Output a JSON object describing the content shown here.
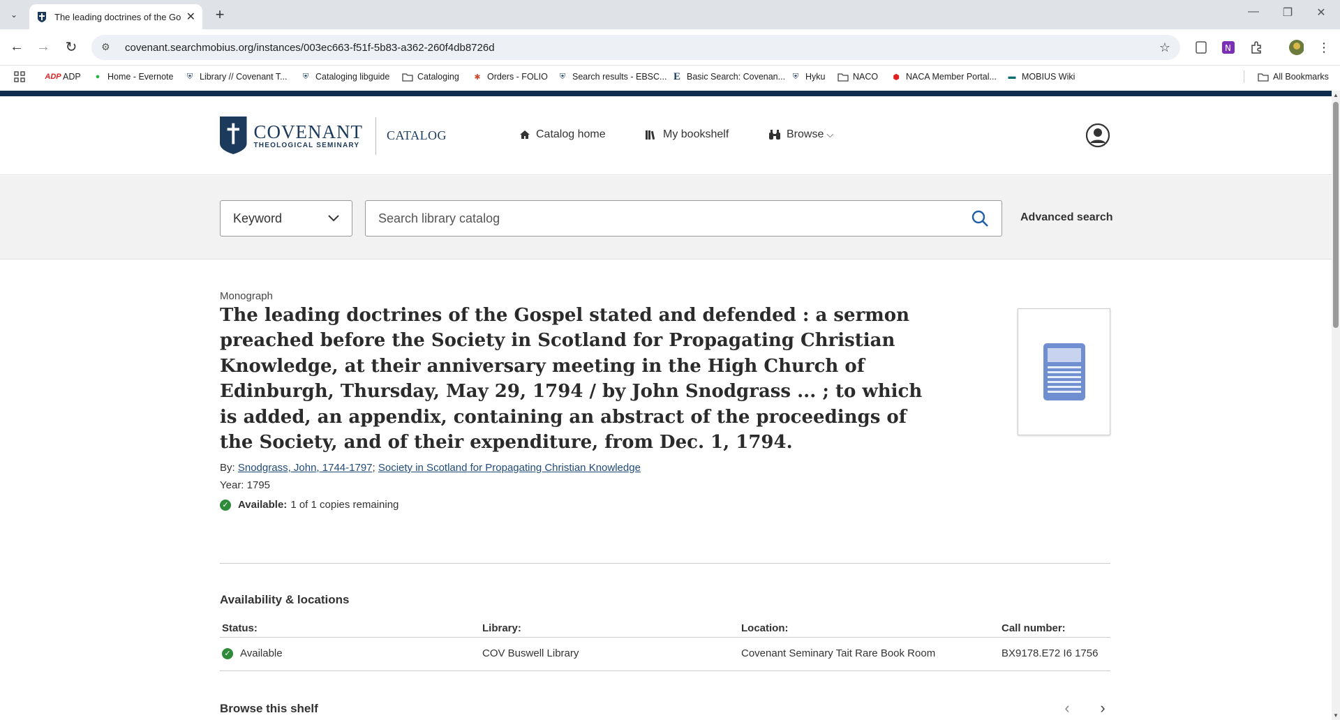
{
  "browser": {
    "tab_title": "The leading doctrines of the Gosp",
    "url": "covenant.searchmobius.org/instances/003ec663-f51f-5b83-a362-260f4db8726d",
    "bookmarks": [
      "ADP",
      "Home - Evernote",
      "Library // Covenant T...",
      "Cataloging libguide",
      "Cataloging",
      "Orders - FOLIO",
      "Search results - EBSC...",
      "Basic Search: Covenan...",
      "Hyku",
      "NACO",
      "NACA Member Portal...",
      "MOBIUS Wiki"
    ],
    "all_bookmarks": "All Bookmarks",
    "icons": [
      "back-icon",
      "forward-icon",
      "reload-icon",
      "star-icon",
      "extensions-icon"
    ]
  },
  "site": {
    "logo_line1": "COVENANT",
    "logo_line2": "THEOLOGICAL SEMINARY",
    "section": "CATALOG",
    "nav": {
      "home": "Catalog home",
      "bookshelf": "My bookshelf",
      "browse": "Browse"
    },
    "colors": {
      "brand": "#0f2e4f",
      "link": "#1f4a7a",
      "available": "#2e8b3a"
    }
  },
  "search": {
    "type_selected": "Keyword",
    "placeholder": "Search library catalog",
    "advanced": "Advanced search"
  },
  "record": {
    "format": "Monograph",
    "title": "The leading doctrines of the Gospel stated and defended : a sermon preached before the Society in Scotland for Propagating Christian Knowledge, at their anniversary meeting in the High Church of Edinburgh, Thursday, May 29, 1794 / by John Snodgrass ... ; to which is added, an appendix, containing an abstract of the proceedings of the Society, and of their expenditure, from Dec. 1, 1794.",
    "by_label": "By:",
    "author1": "Snodgrass, John, 1744-1797",
    "sep": ";",
    "author2": "Society in Scotland for Propagating Christian Knowledge",
    "year_label": "Year:",
    "year": "1795",
    "avail_label": "Available:",
    "avail_text": "1 of 1 copies remaining"
  },
  "availability": {
    "heading": "Availability & locations",
    "headers": {
      "status": "Status:",
      "library": "Library:",
      "location": "Location:",
      "call": "Call number:"
    },
    "row": {
      "status": "Available",
      "library": "COV Buswell Library",
      "location": "Covenant Seminary Tait Rare Book Room",
      "call": "BX9178.E72 I6 1756"
    }
  },
  "shelf": {
    "heading": "Browse this shelf"
  }
}
